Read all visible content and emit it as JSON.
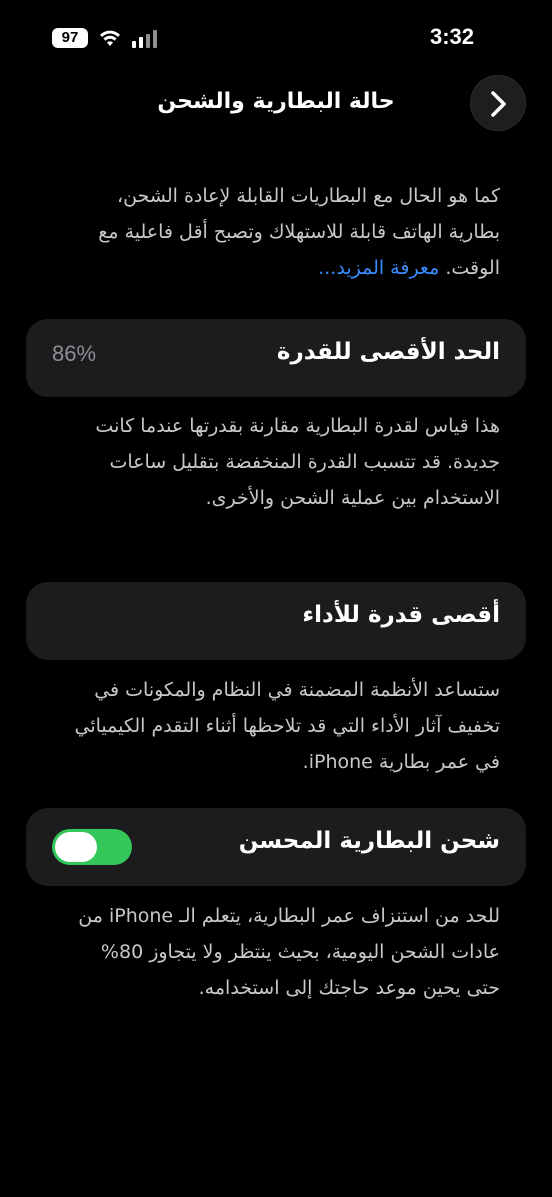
{
  "status_bar": {
    "battery_level": "97",
    "time": "3:32"
  },
  "header": {
    "title": "حالة البطارية والشحن",
    "back_icon": "chevron-right-icon"
  },
  "intro": {
    "text": "كما هو الحال مع البطاريات القابلة لإعادة الشحن، بطارية الهاتف قابلة للاستهلاك وتصبح أقل فاعلية مع الوقت.",
    "learn_more": "معرفة المزيد..."
  },
  "max_capacity": {
    "label": "الحد الأقصى للقدرة",
    "value": "86%",
    "description": "هذا قياس لقدرة البطارية مقارنة بقدرتها عندما كانت جديدة. قد تتسبب القدرة المنخفضة بتقليل ساعات الاستخدام بين عملية الشحن والأخرى."
  },
  "peak_performance": {
    "label": "أقصى قدرة للأداء",
    "description": "ستساعد الأنظمة المضمنة في النظام والمكونات في تخفيف آثار الأداء التي قد تلاحظها أثناء التقدم الكيميائي في عمر بطارية iPhone."
  },
  "optimized_charging": {
    "label": "شحن البطارية المحسن",
    "enabled": true,
    "toggle_color": "#34c759",
    "description": "للحد من استنزاف عمر البطارية، يتعلم الـ iPhone من عادات الشحن اليومية، بحيث ينتظر ولا يتجاوز 80% حتى يحين موعد حاجتك إلى استخدامه."
  }
}
